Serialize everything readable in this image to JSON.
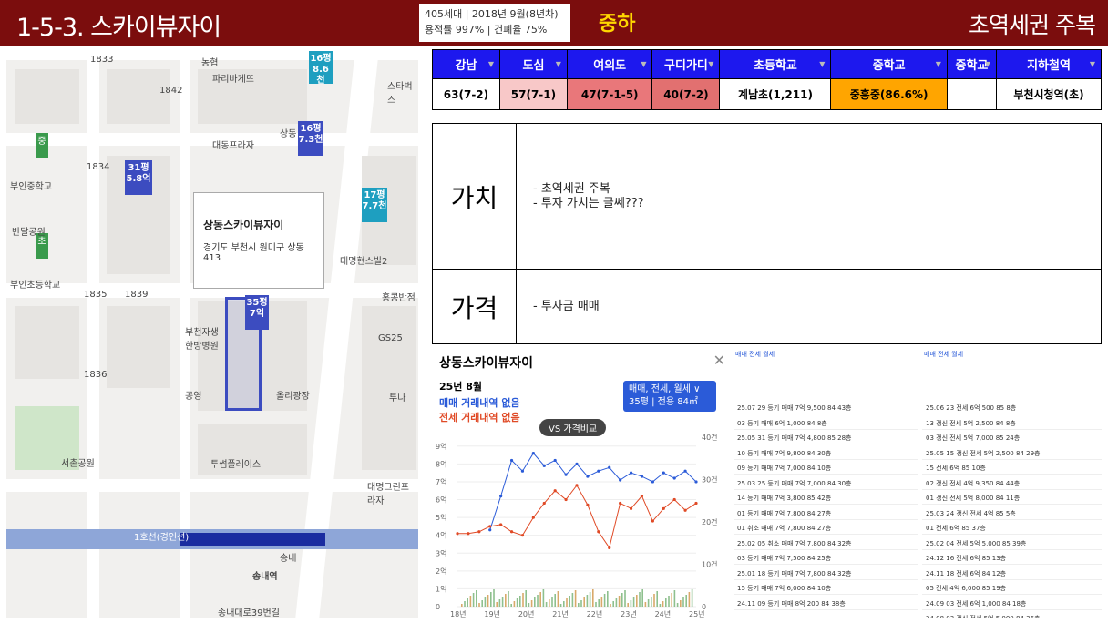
{
  "header": {
    "title": "1-5-3. 스카이뷰자이",
    "info_line1": "405세대 | 2018년 9월(8년차)",
    "info_line2": "용적률 997% | 건폐율 75%",
    "grade": "중하",
    "tagline": "초역세권 주복"
  },
  "colors": {
    "bar": "#7b0d0d",
    "grade": "#ffd700",
    "table_head": "#1d18ee"
  },
  "map": {
    "pins": [
      {
        "top": "16평",
        "price": "8.6천",
        "style": "teal"
      },
      {
        "top": "16평",
        "price": "7.3천",
        "style": "blue"
      },
      {
        "top": "31평",
        "price": "5.8억",
        "style": "blue"
      },
      {
        "top": "17평",
        "price": "7.7천",
        "style": "teal"
      },
      {
        "top": "35평",
        "price": "7억",
        "style": "blue"
      }
    ],
    "labels": [
      "1833",
      "1842",
      "1834",
      "1839",
      "1836",
      "1835",
      "부인중학교",
      "부인초등학교",
      "반달공원",
      "대동프라자",
      "파리바게뜨",
      "농협",
      "상동",
      "송내역",
      "송내대로39번길",
      "서촌공원",
      "공영",
      "부천자생한방병원",
      "투썸플레이스",
      "대명그린프라자",
      "투나",
      "올리광장",
      "대명현스빌2",
      "1호선(경인선)",
      "송내",
      "홍콩반점",
      "GS25",
      "스타벅스"
    ],
    "popup_name": "상동스카이뷰자이",
    "popup_addr": "경기도 부천시 원미구 상동 413"
  },
  "schools": {
    "headers": [
      "강남",
      "도심",
      "여의도",
      "구디가디",
      "초등학교",
      "중학교",
      "중학교",
      "지하철역"
    ],
    "values": [
      "63(7-2)",
      "57(7-1)",
      "47(7-1-5)",
      "40(7-2)",
      "계남초(1,211)",
      "중흥중(86.6%)",
      "",
      "부천시청역(초)"
    ],
    "cell_colors": [
      "#ffffff",
      "#f8c8c8",
      "#e9777a",
      "#e27070",
      "#ffffff",
      "#ffa500",
      "#ffffff",
      "#ffffff"
    ]
  },
  "valuation": {
    "value_label": "가치",
    "value_items": [
      "- 초역세권 주복",
      "- 투자 가치는 글쎄???"
    ],
    "price_label": "가격",
    "price_items": [
      "- 투자금 매매"
    ]
  },
  "chart_panel": {
    "title": "상동스카이뷰자이",
    "month": "25년 8월",
    "note_sale": "매매 거래내역 없음",
    "note_rent": "전세 거래내역 없음",
    "selector": "매매, 전세, 월세 ∨",
    "selector2": "35평 | 전용 84㎡",
    "vs_label": "VS 가격비교"
  },
  "chart_data": {
    "type": "line",
    "x": [
      "18년",
      "19년",
      "20년",
      "21년",
      "22년",
      "23년",
      "24년",
      "25년"
    ],
    "y_left_ticks": [
      "0",
      "1억",
      "2억",
      "3억",
      "4억",
      "5억",
      "6억",
      "7억",
      "8억",
      "9억"
    ],
    "y_right_ticks": [
      "0",
      "10건",
      "20건",
      "30건",
      "40건"
    ],
    "ylim": [
      0,
      9.5
    ],
    "series": [
      {
        "name": "매매",
        "color": "#2b5bd8",
        "values": [
          null,
          null,
          null,
          4.3,
          6.2,
          8.2,
          7.6,
          8.6,
          7.9,
          8.2,
          7.4,
          8.0,
          7.3,
          7.6,
          7.8,
          7.1,
          7.5,
          7.3,
          7.0,
          7.5,
          7.2,
          7.6,
          7.0
        ]
      },
      {
        "name": "전세",
        "color": "#e04a26",
        "values": [
          4.1,
          4.1,
          4.2,
          4.5,
          4.6,
          4.2,
          4.0,
          5.0,
          5.8,
          6.5,
          6.0,
          6.8,
          5.7,
          4.2,
          3.3,
          5.8,
          5.5,
          6.2,
          4.8,
          5.5,
          6.0,
          5.4,
          5.8
        ]
      }
    ]
  },
  "list1": {
    "header": "매매  전세  월세",
    "rows": [
      "25.07 29 등기 매매 7억 9,500 84 43층",
      "03 등기 매매 6억 1,000 84 8층",
      "25.05 31 등기 매매 7억 4,800 85 28층",
      "10 등기 매매 7억 9,800 84 30층",
      "09 등기 매매 7억 7,000 84 10층",
      "25.03 25 등기 매매 7억 7,000 84 30층",
      "14 등기 매매 7억 3,800 85 42층",
      "01 등기 매매 7억 7,800 84 27층",
      "01 취소 매매 7억 7,800 84 27층",
      "25.02 05 취소 매매 7억 7,800 84 32층",
      "03 등기 매매 7억 7,500 84 25층",
      "25.01 18 등기 매매 7억 7,800 84 32층",
      "15 등기 매매 7억 6,000 84 10층",
      "24.11 09 등기 매매 8억 200 84 38층"
    ]
  },
  "list2": {
    "header": "매매  전세  월세",
    "rows": [
      "25.06 23 전세 6억 500 85 8층",
      "13 갱신 전세 5억 2,500 84 8층",
      "03 갱신 전세 5억 7,000 85 24층",
      "25.05 15 갱신 전세 5억 2,500 84 29층",
      "15 전세 6억 85 10층",
      "02 갱신 전세 4억 9,350 84 44층",
      "01 갱신 전세 5억 8,000 84 11층",
      "25.03 24 갱신 전세 4억 85 5층",
      "01 전세 6억 85 37층",
      "25.02 04 전세 5억 5,000 85 39층",
      "24.12 16 전세 6억 85 13층",
      "24.11 18 전세 6억 84 12층",
      "05 전세 4억 6,000 85 19층",
      "24.09 03 전세 6억 1,000 84 18층",
      "24.08 03 갱신 전세 5억 5,000 84 36층"
    ]
  }
}
